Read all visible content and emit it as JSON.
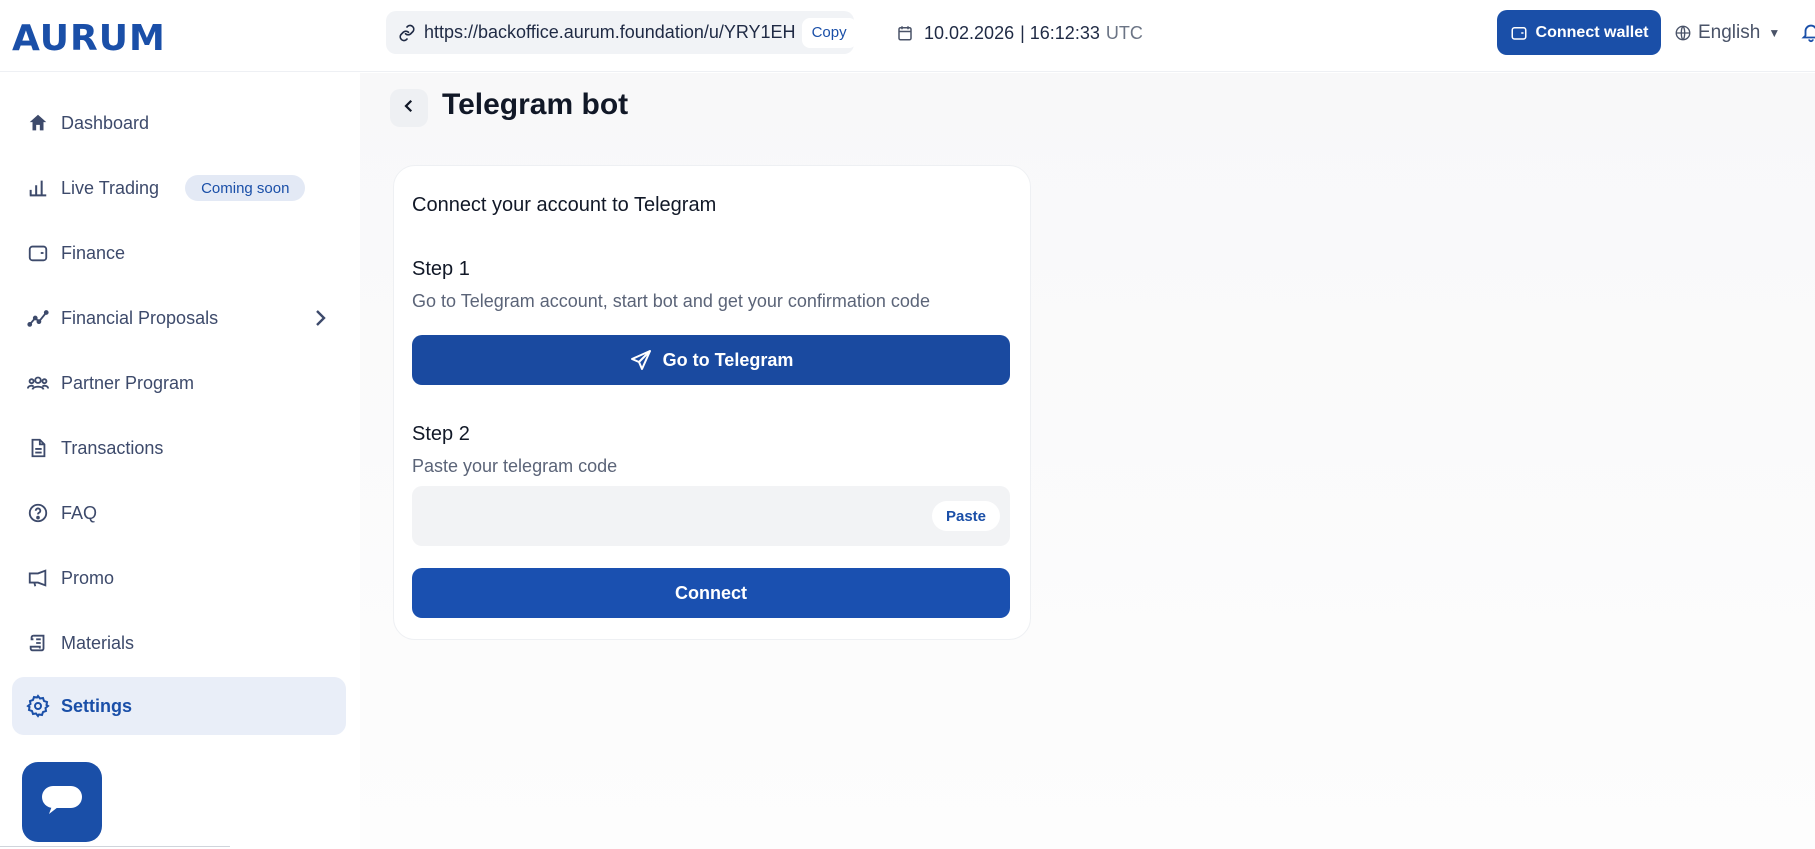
{
  "brand": {
    "logo_text": "AURUM"
  },
  "header": {
    "referral_url": "https://backoffice.aurum.foundation/u/YRY1EH",
    "copy_label": "Copy",
    "date": "10.02.2026",
    "time": "| 16:12:33",
    "timezone": "UTC",
    "connect_wallet_label": "Connect wallet",
    "language": "English"
  },
  "sidebar": {
    "items": [
      {
        "label": "Dashboard",
        "icon": "home-icon"
      },
      {
        "label": "Live Trading",
        "icon": "bar-chart-icon",
        "badge": "Coming soon"
      },
      {
        "label": "Finance",
        "icon": "wallet-icon"
      },
      {
        "label": "Financial Proposals",
        "icon": "trend-line-icon"
      },
      {
        "label": "Partner Program",
        "icon": "users-icon"
      },
      {
        "label": "Transactions",
        "icon": "document-icon"
      },
      {
        "label": "FAQ",
        "icon": "question-icon"
      },
      {
        "label": "Promo",
        "icon": "megaphone-icon"
      },
      {
        "label": "Materials",
        "icon": "scroll-icon"
      },
      {
        "label": "Settings",
        "icon": "gear-icon",
        "active": true
      }
    ]
  },
  "page": {
    "title": "Telegram bot",
    "card": {
      "title": "Connect your account to Telegram",
      "step1": {
        "title": "Step 1",
        "description": "Go to Telegram account, start bot and get your confirmation code",
        "button_label": "Go to Telegram"
      },
      "step2": {
        "title": "Step 2",
        "description": "Paste your telegram code",
        "input_value": "",
        "paste_label": "Paste"
      },
      "connect_label": "Connect"
    }
  },
  "colors": {
    "accent": "#1a4fa8",
    "active_nav_bg": "#e9eef8",
    "badge_bg": "#e3e9f5"
  }
}
